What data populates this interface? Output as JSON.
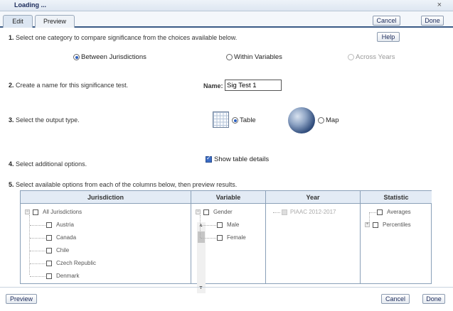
{
  "window": {
    "title": "Loading ...",
    "close_glyph": "×"
  },
  "tabs": [
    {
      "label": "Edit",
      "active": true
    },
    {
      "label": "Preview",
      "active": false
    }
  ],
  "toolbar": {
    "cancel_label": "Cancel",
    "done_label": "Done",
    "help_label": "Help"
  },
  "steps": {
    "s1": {
      "num": "1.",
      "text": "Select one category to compare significance from the choices available below."
    },
    "s2": {
      "num": "2.",
      "text": "Create a name for this significance test."
    },
    "s3": {
      "num": "3.",
      "text": "Select the output type."
    },
    "s4": {
      "num": "4.",
      "text": "Select additional options."
    },
    "s5": {
      "num": "5.",
      "text": "Select available options from each of the columns below, then preview results."
    }
  },
  "category_options": [
    {
      "label": "Between Jurisdictions",
      "selected": true,
      "enabled": true
    },
    {
      "label": "Within Variables",
      "selected": false,
      "enabled": true
    },
    {
      "label": "Across Years",
      "selected": false,
      "enabled": false
    }
  ],
  "name_field": {
    "label": "Name:",
    "value": "Sig Test 1"
  },
  "output_type": {
    "table_label": "Table",
    "map_label": "Map",
    "selected": "Table"
  },
  "options": {
    "show_table_details_label": "Show table details",
    "show_table_details_checked": true
  },
  "columns": {
    "jurisdiction": {
      "header": "Jurisdiction",
      "root": "All Jurisdictions",
      "items": [
        "Austria",
        "Canada",
        "Chile",
        "Czech Republic",
        "Denmark"
      ]
    },
    "variable": {
      "header": "Variable",
      "root": "Gender",
      "items": [
        "Male",
        "Female"
      ]
    },
    "year": {
      "header": "Year",
      "items": [
        "PIAAC 2012-2017"
      ]
    },
    "statistic": {
      "header": "Statistic",
      "items": [
        "Averages",
        "Percentiles"
      ]
    }
  },
  "footer": {
    "preview_label": "Preview",
    "cancel_label": "Cancel",
    "done_label": "Done"
  }
}
